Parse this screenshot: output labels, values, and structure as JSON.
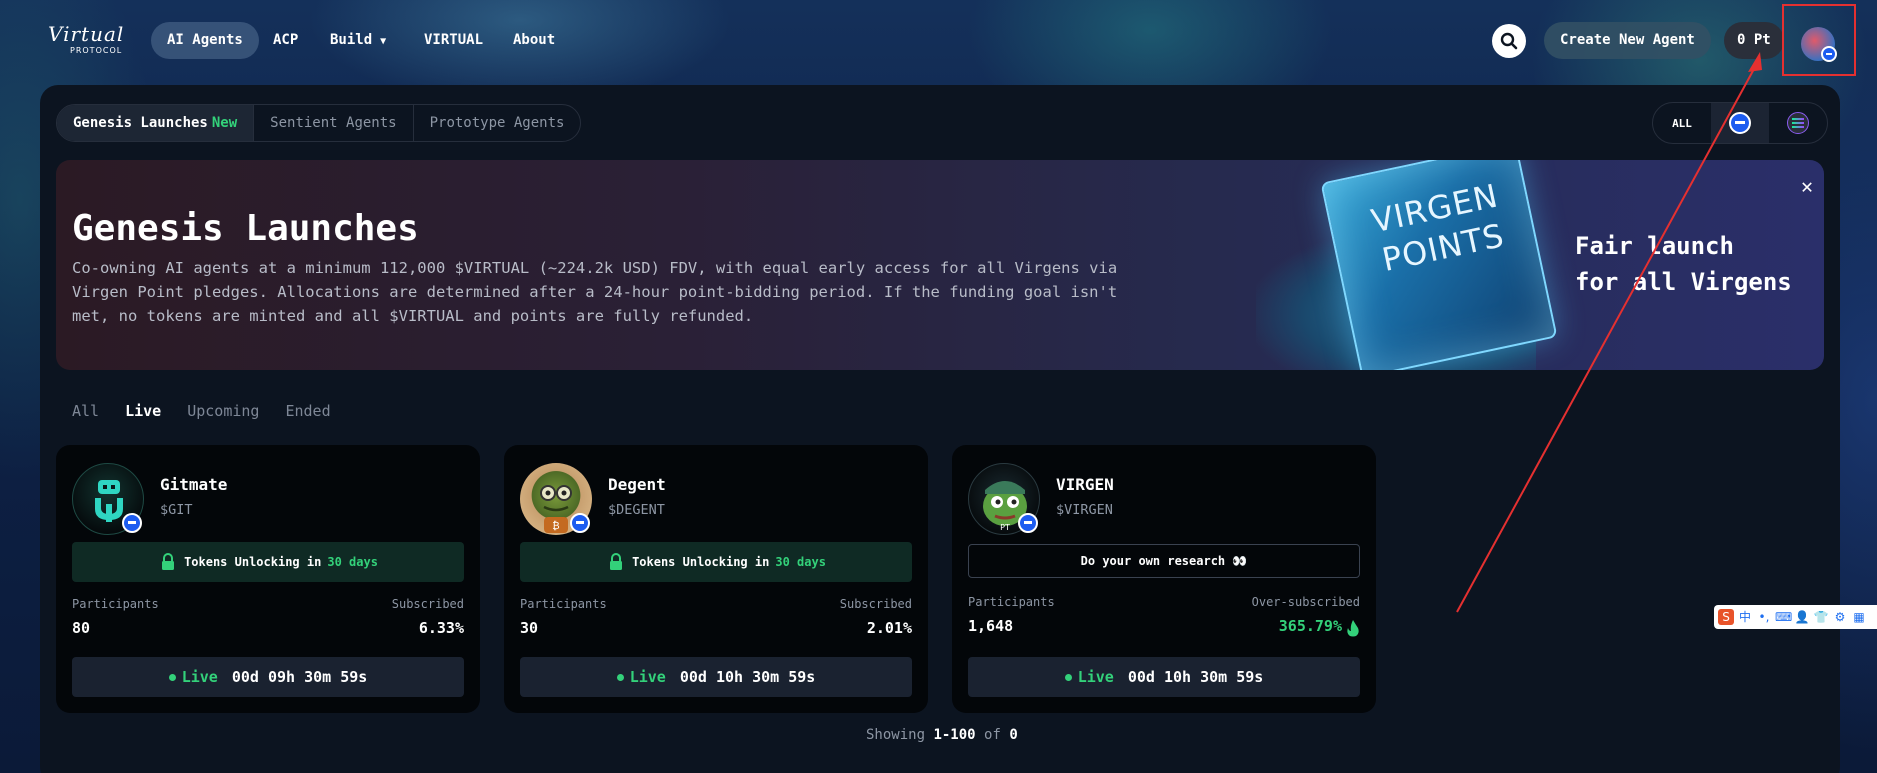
{
  "brand": {
    "logo_script": "Virtual",
    "logo_sub": "PROTOCOL"
  },
  "nav": {
    "items": [
      "AI Agents",
      "ACP",
      "Build",
      "VIRTUAL",
      "About"
    ],
    "create_label": "Create New Agent",
    "points_label": "0 Pt"
  },
  "tabs": {
    "genesis": "Genesis Launches",
    "genesis_badge": "New",
    "sentient": "Sentient Agents",
    "prototype": "Prototype Agents"
  },
  "chain_filter": {
    "all": "ALL"
  },
  "banner": {
    "title": "Genesis Launches",
    "text": "Co-owning AI agents at a minimum 112,000 $VIRTUAL (~224.2k USD) FDV, with equal early access for all Virgens via Virgen Point pledges. Allocations are determined after a 24-hour point-bidding period. If the funding goal isn't met, no tokens are minted and all $VIRTUAL and points are fully refunded.",
    "cube_line1": "VIRGEN",
    "cube_line2": "POINTS",
    "slogan_line1": "Fair launch",
    "slogan_line2": "for all Virgens"
  },
  "status_filters": [
    "All",
    "Live",
    "Upcoming",
    "Ended"
  ],
  "cards": [
    {
      "name": "Gitmate",
      "ticker": "$GIT",
      "unlock_prefix": "Tokens Unlocking in",
      "unlock_days": "30 days",
      "participants_label": "Participants",
      "participants": "80",
      "subscribed_label": "Subscribed",
      "subscribed": "6.33%",
      "live_label": "Live",
      "time": "00d 09h 30m 59s",
      "accent": "#2fd6c2"
    },
    {
      "name": "Degent",
      "ticker": "$DEGENT",
      "unlock_prefix": "Tokens Unlocking in",
      "unlock_days": "30 days",
      "participants_label": "Participants",
      "participants": "30",
      "subscribed_label": "Subscribed",
      "subscribed": "2.01%",
      "live_label": "Live",
      "time": "00d 10h 30m 59s",
      "accent": "#6a8a3a"
    },
    {
      "name": "VIRGEN",
      "ticker": "$VIRGEN",
      "dyor": "Do your own research 👀",
      "participants_label": "Participants",
      "participants": "1,648",
      "subscribed_label": "Over-subscribed",
      "subscribed": "365.79%",
      "live_label": "Live",
      "time": "00d 10h 30m 59s",
      "accent": "#5aa040"
    }
  ],
  "footer": {
    "showing_prefix": "Showing",
    "range": "1-100",
    "of": "of",
    "total": "0"
  },
  "ime": {
    "chars": [
      "中",
      "•,"
    ]
  },
  "colors": {
    "green": "#33d17a",
    "panel": "#0c1420",
    "card": "#030609",
    "annotation": "#e53030"
  }
}
